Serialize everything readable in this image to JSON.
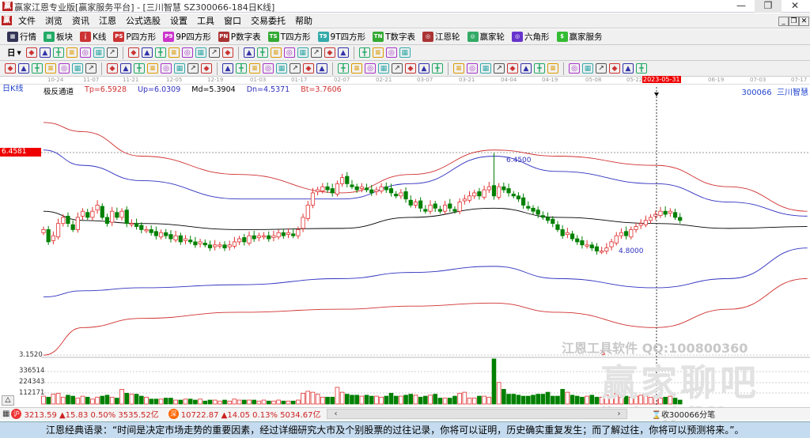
{
  "window": {
    "title": "赢家江恩专业版[赢家服务平台] - [三川智慧  SZ300066-184日K线]",
    "logo": "赢",
    "min": "—",
    "max": "❐",
    "close": "✕"
  },
  "menu": [
    "文件",
    "浏览",
    "资讯",
    "江恩",
    "公式选股",
    "设置",
    "工具",
    "窗口",
    "交易委托",
    "帮助"
  ],
  "mdi": [
    "_",
    "❐",
    "✕"
  ],
  "toolbar1": [
    {
      "label": "行情",
      "icon": "grid-icon",
      "glyph": "▦",
      "color": "#335"
    },
    {
      "label": "板块",
      "icon": "blocks-icon",
      "glyph": "▩",
      "color": "#2a6"
    },
    {
      "label": "K线",
      "icon": "kline-icon",
      "glyph": "╽",
      "color": "#c33"
    },
    {
      "label": "P四方形",
      "icon": "p-square-icon",
      "glyph": "PS",
      "color": "#c33"
    },
    {
      "label": "9P四方形",
      "icon": "9p-square-icon",
      "glyph": "P9",
      "color": "#c3c"
    },
    {
      "label": "P数字表",
      "icon": "p-number-icon",
      "glyph": "PN",
      "color": "#a33"
    },
    {
      "label": "T四方形",
      "icon": "t-square-icon",
      "glyph": "TS",
      "color": "#3a3"
    },
    {
      "label": "9T四方形",
      "icon": "9t-square-icon",
      "glyph": "T9",
      "color": "#3aa"
    },
    {
      "label": "T数字表",
      "icon": "t-number-icon",
      "glyph": "TN",
      "color": "#3a3"
    },
    {
      "label": "江恩轮",
      "icon": "gann-wheel-icon",
      "glyph": "◎",
      "color": "#a33"
    },
    {
      "label": "赢家轮",
      "icon": "winner-wheel-icon",
      "glyph": "◎",
      "color": "#3a6"
    },
    {
      "label": "六角形",
      "icon": "hexagon-icon",
      "glyph": "◎",
      "color": "#63c"
    },
    {
      "label": "赢家服务",
      "icon": "dollar-icon",
      "glyph": "$",
      "color": "#3b3"
    }
  ],
  "toolbar2": {
    "period": "日",
    "icons": [
      "line-icon",
      "note-icon",
      "indicator-a-icon",
      "indicator-b-icon",
      "bar-type-icon",
      "fan-icon",
      "color-icon",
      "first-icon",
      "last-icon",
      "prev-icon",
      "next-icon",
      "zoom-a-icon",
      "zoom-b-icon",
      "zoom-c-icon",
      "zoom-d-icon",
      "zoom-e-icon",
      "zoom-f-icon",
      "hand-icon",
      "crosshair-icon",
      "draw-icon",
      "calc-icon",
      "formula-icon",
      "calendar-icon",
      "calculator-icon",
      "table-icon",
      "save-icon",
      "truck-icon"
    ]
  },
  "toolbar3": {
    "icons": [
      "pen-icon",
      "lines-icon",
      "gold-a-icon",
      "gold-b-icon",
      "fib-icon",
      "arc-icon",
      "eraser-icon",
      "circle-icon",
      "cycle-icon",
      "n2-icon",
      "angle-icon",
      "target-icon",
      "star-icon",
      "box-icon",
      "gann-line-icon",
      "red-line-icon",
      "red-box-icon",
      "grid-line-icon",
      "period-icon",
      "rect-icon",
      "fan-red-icon",
      "square-icon",
      "diag-icon",
      "cross-line-icon",
      "speed-icon",
      "grid2-icon",
      "grid3-icon",
      "parallel-icon",
      "bracket-icon",
      "percent-line-icon",
      "percent-icon",
      "trend-a-icon",
      "gold-circle-icon",
      "gold-line-icon",
      "pitch-icon",
      "av-icon",
      "gold-box-icon",
      "fork-a-icon",
      "fork-b-icon",
      "fork-c-icon",
      "fork-d-icon",
      "fork-e-icon",
      "fork-f-icon",
      "yin-yang-icon",
      "infinity-icon"
    ]
  },
  "dates": [
    "10-24",
    "11-07",
    "11-21",
    "12-05",
    "12-19",
    "01-03",
    "01-17",
    "02-07",
    "02-21",
    "03-07",
    "03-21",
    "04-04",
    "04-19",
    "05-08",
    "05-22",
    "2023-05-31",
    "06-19",
    "07-03",
    "07-17"
  ],
  "chart_label": "日K线",
  "indicator": {
    "name": "极反通道",
    "tp": "Tp=6.5928",
    "up": "Up=6.0309",
    "md": "Md=5.3904",
    "dn": "Dn=4.5371",
    "bt": "Bt=3.7606"
  },
  "stock": "300066  三川智慧",
  "cursor_price": "6.4581",
  "high_label": "6.4500",
  "low_label": "4.8000",
  "bottom_price": "3.1520",
  "volume_ticks": [
    "336514",
    "224343",
    "112171"
  ],
  "colors": {
    "up": "#e03030",
    "down": "#008000",
    "tp": "#d03030",
    "up_band": "#3030c0",
    "md": "#000000",
    "dn": "#3030c0",
    "bt": "#d03030"
  },
  "watermark": {
    "line1": "江恩工具软件  QQ:100800360",
    "line2": "赢家聊吧",
    "line3": "liaoba.yjcf360.com"
  },
  "status": {
    "sh": {
      "badge": "沪",
      "text": "3213.59 ▲15.83 0.50% 3535.52亿"
    },
    "sz": {
      "badge": "深",
      "text": "10722.87 ▲14.05 0.13% 5034.67亿"
    },
    "tick": "收300066分笔"
  },
  "quote": "江恩经典语录：“时间是决定市场走势的重要因素，经过详细研究大市及个别股票的过往记录，你将可以证明，历史确实重复发生；而了解过往，你将可以预测将来。”。",
  "chart_data": {
    "type": "candlestick",
    "title": "三川智慧 SZ300066 日K线",
    "ylim": [
      3.152,
      6.4581
    ],
    "closes": [
      5.2,
      5.0,
      5.1,
      5.3,
      5.4,
      5.3,
      5.2,
      5.4,
      5.5,
      5.4,
      5.5,
      5.6,
      5.4,
      5.3,
      5.5,
      5.4,
      5.5,
      5.3,
      5.3,
      5.25,
      5.2,
      5.2,
      5.15,
      5.1,
      5.15,
      5.1,
      5.05,
      5.1,
      5.0,
      5.05,
      5.0,
      4.95,
      5.0,
      4.95,
      4.9,
      4.95,
      4.95,
      4.9,
      4.95,
      5.0,
      5.05,
      5.0,
      5.1,
      5.05,
      5.1,
      5.1,
      5.05,
      5.1,
      5.15,
      5.1,
      5.15,
      5.1,
      5.2,
      5.4,
      5.6,
      5.8,
      5.85,
      5.9,
      5.85,
      5.8,
      5.95,
      6.05,
      5.95,
      5.9,
      5.85,
      5.9,
      5.85,
      5.8,
      5.85,
      5.9,
      5.85,
      5.8,
      5.75,
      5.8,
      5.7,
      5.6,
      5.65,
      5.55,
      5.5,
      5.6,
      5.55,
      5.5,
      5.6,
      5.55,
      5.5,
      5.65,
      5.7,
      5.75,
      5.8,
      5.75,
      5.85,
      5.9,
      5.75,
      5.9,
      5.85,
      5.8,
      5.75,
      5.7,
      5.6,
      5.55,
      5.5,
      5.45,
      5.4,
      5.35,
      5.3,
      5.2,
      5.1,
      5.15,
      5.05,
      5.0,
      4.95,
      4.95,
      4.9,
      4.85,
      4.85,
      4.9,
      5.0,
      5.1,
      5.15,
      5.1,
      5.2,
      5.25,
      5.3,
      5.35,
      5.4,
      5.45,
      5.5,
      5.45,
      5.5,
      5.4,
      5.35
    ],
    "spike": {
      "index": 92,
      "high": 6.45
    },
    "low_mark": {
      "index": 114,
      "low": 4.8
    },
    "volumes": [
      80000,
      70000,
      100000,
      110000,
      70000,
      90000,
      80000,
      60000,
      80000,
      70000,
      50000,
      70000,
      80000,
      90000,
      70000,
      60000,
      150000,
      110000,
      100000,
      100000,
      80000,
      70000,
      50000,
      50000,
      50000,
      60000,
      60000,
      40000,
      40000,
      50000,
      50000,
      40000,
      50000,
      30000,
      40000,
      40000,
      30000,
      40000,
      30000,
      50000,
      40000,
      40000,
      40000,
      40000,
      30000,
      40000,
      30000,
      30000,
      40000,
      30000,
      30000,
      30000,
      40000,
      110000,
      130000,
      120000,
      100000,
      70000,
      70000,
      70000,
      170000,
      120000,
      100000,
      90000,
      90000,
      80000,
      90000,
      80000,
      80000,
      70000,
      80000,
      110000,
      80000,
      80000,
      90000,
      100000,
      90000,
      70000,
      80000,
      90000,
      100000,
      60000,
      60000,
      60000,
      80000,
      110000,
      120000,
      60000,
      60000,
      80000,
      80000,
      70000,
      460000,
      220000,
      150000,
      100000,
      100000,
      90000,
      80000,
      80000,
      90000,
      100000,
      100000,
      120000,
      80000,
      80000,
      150000,
      120000,
      90000,
      80000,
      70000,
      80000,
      90000,
      70000,
      70000,
      90000,
      70000,
      110000,
      70000,
      80000,
      70000,
      80000,
      90000,
      80000,
      70000,
      80000,
      60000,
      70000,
      80000,
      60000,
      40000
    ],
    "bands_index": [
      0,
      8,
      20,
      40,
      61,
      75,
      92,
      105,
      125,
      140,
      156
    ],
    "tp": [
      6.95,
      6.8,
      6.4,
      6.1,
      5.8,
      6.1,
      6.5,
      6.4,
      6.25,
      5.9,
      5.5
    ],
    "up": [
      6.5,
      6.25,
      6.0,
      5.7,
      5.7,
      5.95,
      6.4,
      6.15,
      5.95,
      5.65,
      5.42
    ],
    "md": [
      5.5,
      5.35,
      5.3,
      5.2,
      5.22,
      5.4,
      5.55,
      5.4,
      5.3,
      5.22,
      5.25
    ],
    "dn": [
      4.1,
      4.2,
      4.25,
      4.3,
      4.4,
      4.5,
      4.6,
      4.4,
      4.25,
      4.4,
      4.9
    ],
    "bt": [
      3.15,
      3.6,
      3.75,
      3.85,
      3.9,
      3.95,
      4.0,
      3.85,
      3.6,
      3.9,
      4.4
    ],
    "volume_ylim": [
      0,
      470000
    ],
    "cursor_date": "2023-05-31"
  }
}
